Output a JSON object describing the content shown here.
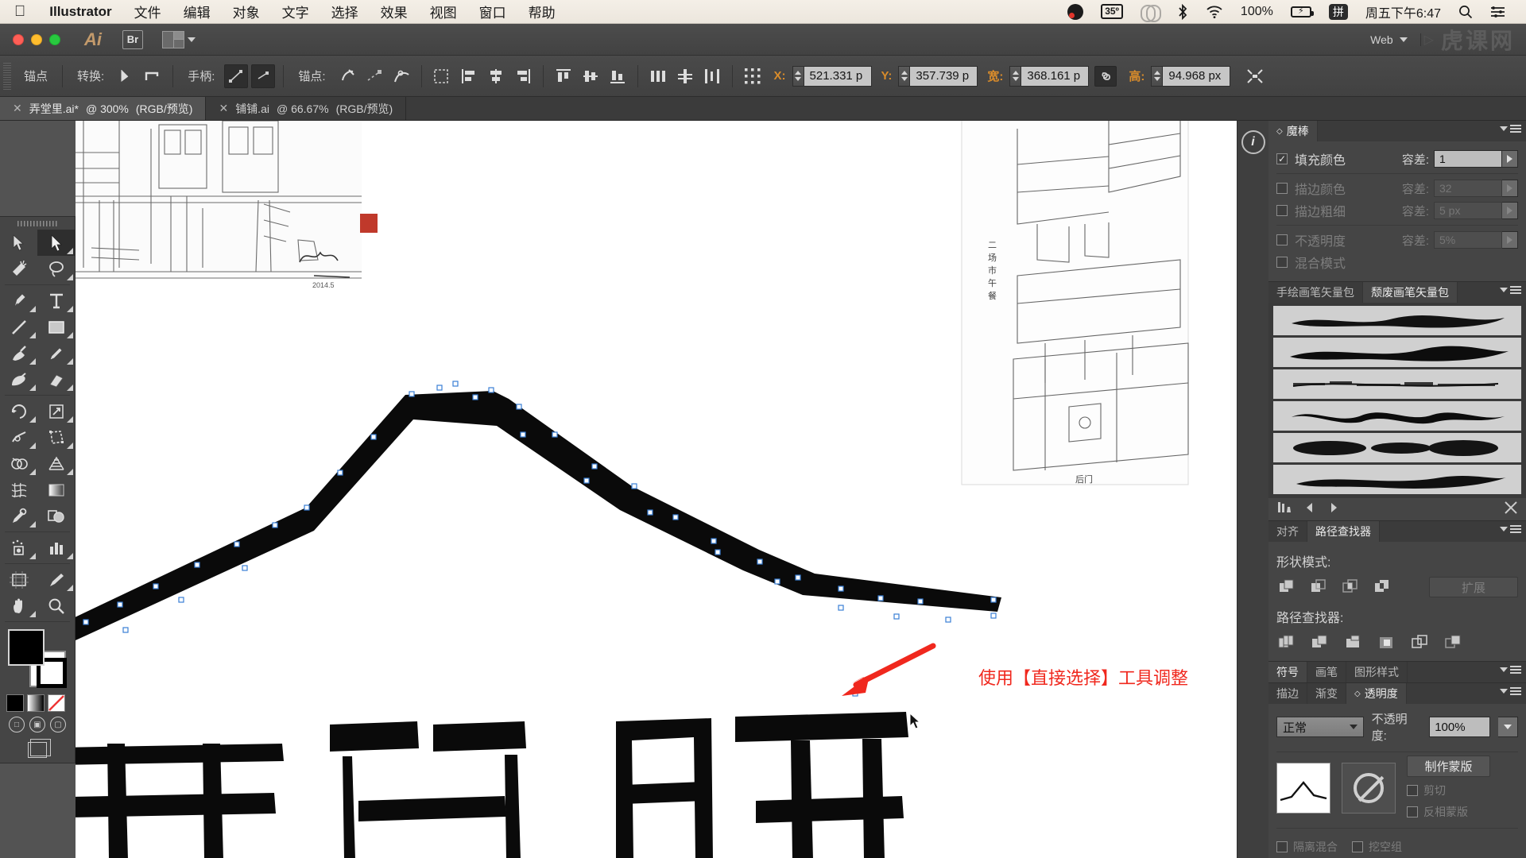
{
  "menubar": {
    "apple_icon": "apple-icon",
    "app_name": "Illustrator",
    "items": [
      "文件",
      "编辑",
      "对象",
      "文字",
      "选择",
      "效果",
      "视图",
      "窗口",
      "帮助"
    ],
    "status": {
      "obs_icon": "obs-record-icon",
      "temperature": "35º",
      "cc_icon": "creative-cloud-icon",
      "bluetooth_icon": "bluetooth-icon",
      "wifi_icon": "wifi-icon",
      "battery_percent": "100%",
      "battery_icon": "battery-charging-icon",
      "input_method": "拼",
      "datetime": "周五下午6:47",
      "search_icon": "search-icon",
      "control_center_icon": "control-center-icon"
    }
  },
  "apptitle": {
    "ai_logo": "Ai",
    "bridge_button": "Br",
    "arrange_label": "arrange-documents",
    "workspace": "Web",
    "watermark": "虎课网"
  },
  "controlbar": {
    "title": "锚点",
    "convert_label": "转换:",
    "handles_label": "手柄:",
    "anchors_label": "锚点:",
    "x_label": "X:",
    "x_value": "521.331 p",
    "y_label": "Y:",
    "y_value": "357.739 p",
    "w_label": "宽:",
    "w_value": "368.161 p",
    "h_label": "高:",
    "h_value": "94.968 px",
    "link_icon": "link-aspect-ratio-icon"
  },
  "tabs": [
    {
      "name": "弄堂里.ai*",
      "zoom": "@ 300%",
      "mode": "(RGB/预览)",
      "active": true
    },
    {
      "name": "铺铺.ai",
      "zoom": "@ 66.67%",
      "mode": "(RGB/预览)",
      "active": false
    }
  ],
  "toolbox": {
    "tools": [
      [
        "selection-tool",
        "direct-selection-tool"
      ],
      [
        "magic-wand-tool",
        "lasso-tool"
      ],
      [
        "pen-tool",
        "type-tool"
      ],
      [
        "line-segment-tool",
        "rectangle-tool"
      ],
      [
        "paintbrush-tool",
        "pencil-tool"
      ],
      [
        "blob-brush-tool",
        "eraser-tool"
      ],
      [
        "rotate-tool",
        "scale-tool"
      ],
      [
        "width-tool",
        "free-transform-tool"
      ],
      [
        "shape-builder-tool",
        "perspective-grid-tool"
      ],
      [
        "mesh-tool",
        "gradient-tool"
      ],
      [
        "eyedropper-tool",
        "blend-tool"
      ],
      [
        "symbol-sprayer-tool",
        "column-graph-tool"
      ],
      [
        "artboard-tool",
        "slice-tool"
      ],
      [
        "hand-tool",
        "zoom-tool"
      ]
    ],
    "fill_color": "#000000",
    "stroke_color": "#ffffff",
    "none_icon": "none-swatch-icon"
  },
  "canvas": {
    "annotation": "使用【直接选择】工具调整",
    "annotation_color": "#f0281e",
    "arrow_icon": "red-arrow-icon",
    "cursor_icon": "arrow-cursor",
    "background": "#ffffff"
  },
  "panels": {
    "magic_wand": {
      "tab_label": "魔棒",
      "rows": [
        {
          "label": "填充颜色",
          "checked": true,
          "tol_label": "容差:",
          "tol_value": "1",
          "enabled": true
        },
        {
          "label": "描边颜色",
          "checked": false,
          "tol_label": "容差:",
          "tol_value": "32",
          "enabled": false
        },
        {
          "label": "描边粗细",
          "checked": false,
          "tol_label": "容差:",
          "tol_value": "5 px",
          "enabled": false
        },
        {
          "label": "不透明度",
          "checked": false,
          "tol_label": "容差:",
          "tol_value": "5%",
          "enabled": false
        },
        {
          "label": "混合模式",
          "checked": false,
          "tol_label": "",
          "tol_value": "",
          "enabled": false
        }
      ]
    },
    "brushes": {
      "tabs": [
        {
          "label": "手绘画笔矢量包",
          "active": false
        },
        {
          "label": "颓废画笔矢量包",
          "active": true
        }
      ],
      "swatch_count": 6,
      "nav": {
        "library_icon": "brush-libraries-icon",
        "prev_icon": "previous-library-icon",
        "next_icon": "next-library-icon",
        "delete_icon": "delete-brush-icon"
      }
    },
    "pathfinder": {
      "tabs": [
        {
          "label": "对齐",
          "active": false
        },
        {
          "label": "路径查找器",
          "active": true
        }
      ],
      "shape_modes_label": "形状模式:",
      "shape_modes": [
        "unite-icon",
        "minus-front-icon",
        "intersect-icon",
        "exclude-icon"
      ],
      "expand_button": "扩展",
      "pathfinders_label": "路径查找器:",
      "pathfinders": [
        "divide-icon",
        "trim-icon",
        "merge-icon",
        "crop-icon",
        "outline-icon",
        "minus-back-icon"
      ]
    },
    "transparency": {
      "top_tabs": [
        {
          "label": "符号",
          "active": true
        },
        {
          "label": "画笔",
          "active": false
        },
        {
          "label": "图形样式",
          "active": false
        }
      ],
      "tabs": [
        {
          "label": "描边",
          "active": false
        },
        {
          "label": "渐变",
          "active": false
        },
        {
          "label": "透明度",
          "active": true
        }
      ],
      "blend_mode": "正常",
      "opacity_label": "不透明度:",
      "opacity_value": "100%",
      "make_mask_button": "制作蒙版",
      "clip_label": "剪切",
      "invert_mask_label": "反相蒙版",
      "isolate_blending_label": "隔离混合",
      "knockout_group_label": "挖空组"
    }
  }
}
